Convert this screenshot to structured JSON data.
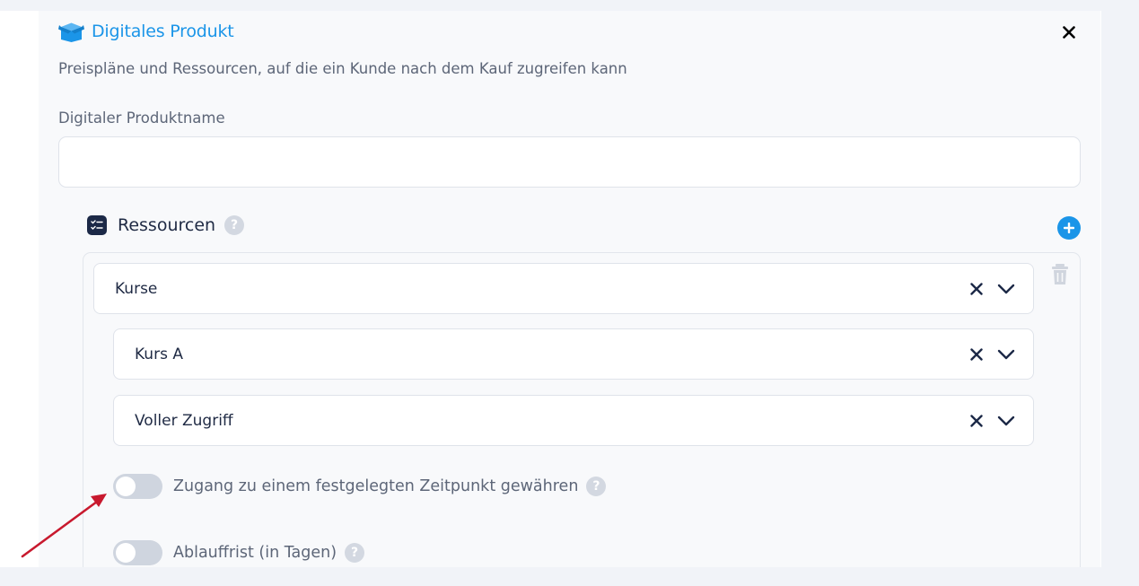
{
  "header": {
    "title": "Digitales Produkt",
    "subtitle": "Preispläne und Ressourcen, auf die ein Kunde nach dem Kauf zugreifen kann",
    "icon": "box-icon",
    "close_icon": "close-icon"
  },
  "form": {
    "name_label": "Digitaler Produktname",
    "name_value": "",
    "name_placeholder": ""
  },
  "resources": {
    "label": "Ressourcen",
    "help_glyph": "?",
    "add_icon": "plus-circle-icon",
    "delete_icon": "trash-icon",
    "type_select": {
      "value": "Kurse"
    },
    "course_select": {
      "value": "Kurs A"
    },
    "access_select": {
      "value": "Voller Zugriff"
    },
    "toggles": [
      {
        "label": "Zugang zu einem festgelegten Zeitpunkt gewähren",
        "on": false
      },
      {
        "label": "Ablauffrist (in Tagen)",
        "on": false
      }
    ]
  },
  "colors": {
    "accent": "#1b95e8",
    "navy": "#1c2947",
    "annotation_arrow": "#c8192e"
  }
}
